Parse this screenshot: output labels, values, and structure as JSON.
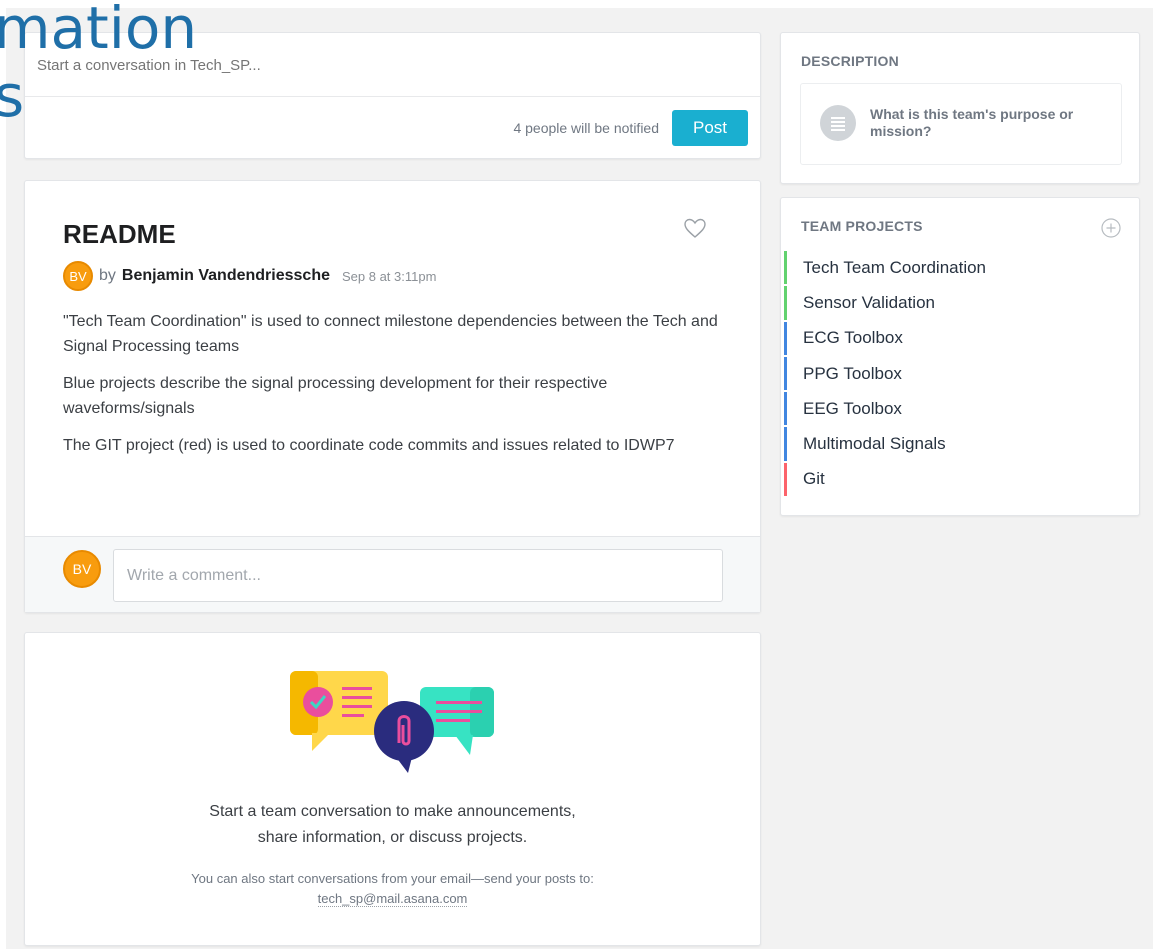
{
  "overlay": {
    "line1": "mation",
    "line2": "s"
  },
  "composer": {
    "placeholder": "Start a conversation in Tech_SP...",
    "notify_text": "4 people will be notified",
    "post_label": "Post"
  },
  "readme": {
    "title": "README",
    "avatar_initials": "BV",
    "by": "by",
    "author": "Benjamin Vandendriessche",
    "date": "Sep 8 at 3:11pm",
    "paragraphs": [
      "\"Tech Team Coordination\" is used to connect milestone dependencies between the Tech and Signal Processing teams",
      "Blue projects describe the signal processing development for their respective waveforms/signals",
      "The GIT project (red) is used to coordinate code commits and issues related to IDWP7"
    ],
    "comment_avatar_initials": "BV",
    "comment_placeholder": "Write a comment..."
  },
  "empty_state": {
    "headline_line1": "Start a team conversation to make announcements,",
    "headline_line2": "share information, or discuss projects.",
    "sub_line1": "You can also start conversations from your email—send your posts to:",
    "email": "tech_sp@mail.asana.com"
  },
  "description": {
    "label": "DESCRIPTION",
    "prompt": "What is this team's purpose or mission?"
  },
  "team_projects": {
    "label": "TEAM PROJECTS",
    "items": [
      {
        "name": "Tech Team Coordination",
        "color": "#62d26f"
      },
      {
        "name": "Sensor Validation",
        "color": "#62d26f"
      },
      {
        "name": "ECG Toolbox",
        "color": "#4186e0"
      },
      {
        "name": "PPG Toolbox",
        "color": "#4186e0"
      },
      {
        "name": "EEG Toolbox",
        "color": "#4186e0"
      },
      {
        "name": "Multimodal Signals",
        "color": "#4186e0"
      },
      {
        "name": "Git",
        "color": "#fc636b"
      }
    ]
  },
  "colors": {
    "accent": "#1aafd0",
    "avatar": "#f89c0e"
  }
}
